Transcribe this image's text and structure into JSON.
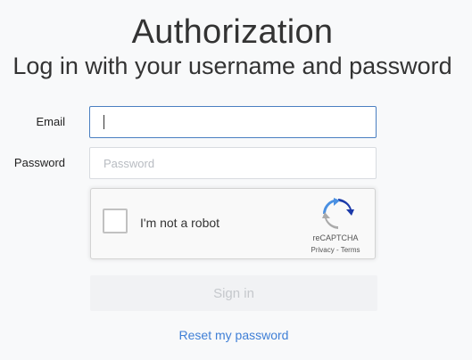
{
  "header": {
    "title": "Authorization",
    "subtitle": "Log in with your username and password"
  },
  "form": {
    "email_label": "Email",
    "email_value": "",
    "email_placeholder": "",
    "password_label": "Password",
    "password_value": "",
    "password_placeholder": "Password",
    "signin_label": "Sign in",
    "reset_link": "Reset my password"
  },
  "recaptcha": {
    "checkbox_label": "I'm not a robot",
    "checked": false,
    "brand": "reCAPTCHA",
    "terms": "Privacy - Terms",
    "logo_icon": "recaptcha-logo-icon"
  },
  "colors": {
    "background": "#f8f9fa",
    "focus_border": "#4a7fc1",
    "link": "#3f7fd6",
    "button_disabled_bg": "#f1f2f4",
    "button_disabled_text": "#c5c8cc"
  }
}
